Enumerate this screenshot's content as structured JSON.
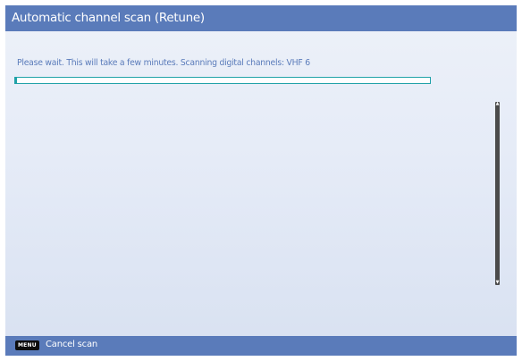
{
  "header": {
    "title": "Automatic channel scan (Retune)"
  },
  "scan": {
    "status_text": "Please wait. This will take a few minutes. Scanning digital channels: VHF 6",
    "progress_fraction": 0.005
  },
  "footer": {
    "key_label": "MENU",
    "action_label": "Cancel scan"
  },
  "colors": {
    "accent": "#5a7bba",
    "progress": "#20a2a8",
    "panel_background": "#e5ebf7",
    "scrollbar": "#4b4b4b"
  },
  "icons": {
    "scroll_up": "scroll-up-arrow-icon",
    "scroll_down": "scroll-down-arrow-icon"
  }
}
